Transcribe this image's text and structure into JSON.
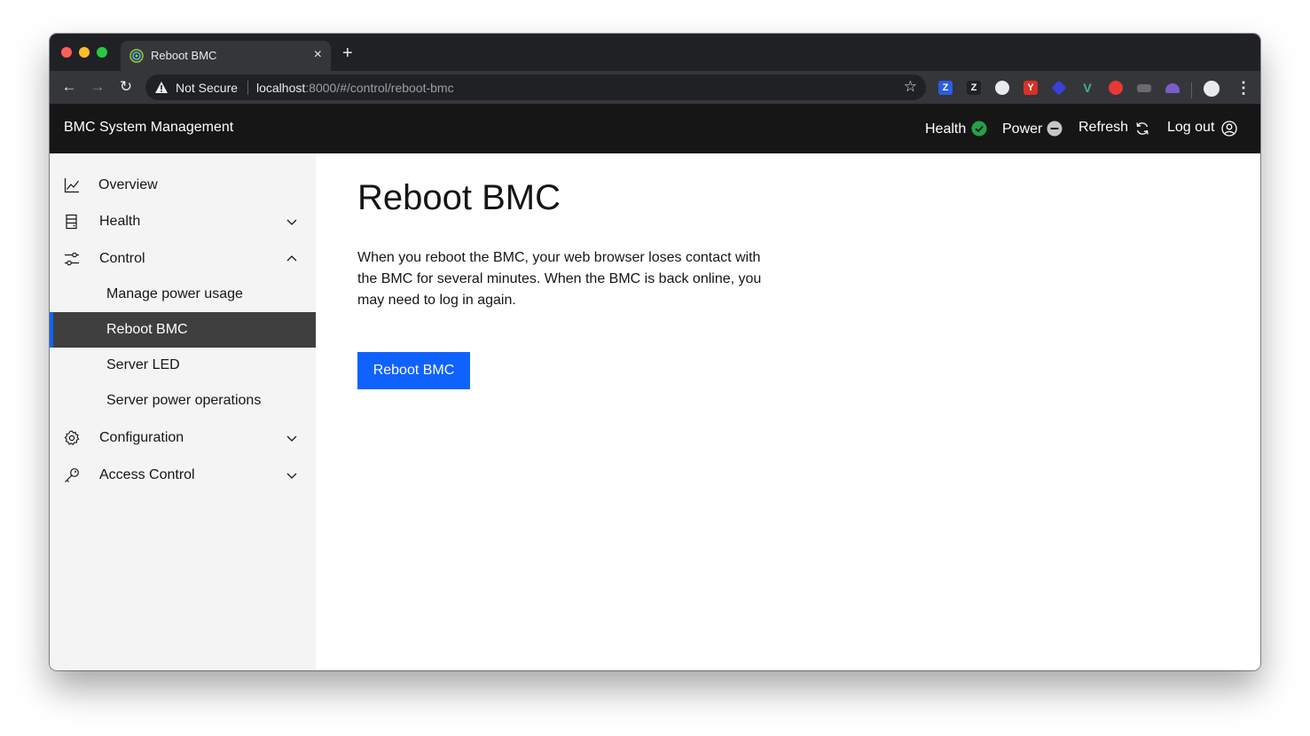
{
  "browser": {
    "tab_title": "Reboot BMC",
    "new_tab_symbol": "+",
    "close_symbol": "×",
    "security_label": "Not Secure",
    "url_host": "localhost",
    "url_rest": ":8000/#/control/reboot-bmc",
    "extensions": [
      {
        "icon": "z-blue-extension-icon",
        "glyph": "Z",
        "color": "#2d5be3"
      },
      {
        "icon": "z-dark-extension-icon",
        "glyph": "Z",
        "color": "#202124"
      },
      {
        "icon": "circle-extension-icon",
        "glyph": "",
        "color": "#e8eaed"
      },
      {
        "icon": "red-y-extension-icon",
        "glyph": "Y",
        "color": "#d93025"
      },
      {
        "icon": "diamond-extension-icon",
        "glyph": "",
        "color": "#3c3fd8"
      },
      {
        "icon": "vue-extension-icon",
        "glyph": "V",
        "color": "#41b883"
      },
      {
        "icon": "red-badge-extension-icon",
        "glyph": "",
        "color": "#e53935"
      },
      {
        "icon": "gray-extension-icon",
        "glyph": "",
        "color": "#6b6b6b"
      },
      {
        "icon": "purple-extension-icon",
        "glyph": "",
        "color": "#7a5cc9"
      }
    ]
  },
  "header": {
    "app_title": "BMC System Management",
    "health_label": "Health",
    "power_label": "Power",
    "refresh_label": "Refresh",
    "logout_label": "Log out",
    "health_color": "#24a148",
    "power_color": "#c6c6c6"
  },
  "sidebar": {
    "items": [
      {
        "label": "Overview",
        "icon": "chart-line-icon"
      },
      {
        "label": "Health",
        "icon": "server-icon",
        "expanded": false
      },
      {
        "label": "Control",
        "icon": "sliders-icon",
        "expanded": true
      },
      {
        "label": "Configuration",
        "icon": "gear-icon",
        "expanded": false
      },
      {
        "label": "Access Control",
        "icon": "key-icon",
        "expanded": false
      }
    ],
    "control_children": [
      {
        "label": "Manage power usage"
      },
      {
        "label": "Reboot BMC",
        "active": true
      },
      {
        "label": "Server LED"
      },
      {
        "label": "Server power operations"
      }
    ]
  },
  "main": {
    "title": "Reboot BMC",
    "description": "When you reboot the BMC, your web browser loses contact with the BMC for several minutes. When the BMC is back online, you may need to log in again.",
    "reboot_button_label": "Reboot BMC"
  },
  "colors": {
    "accent": "#0f62fe",
    "header_bg": "#161616",
    "sidebar_bg": "#f4f4f4",
    "active_nav_bg": "#3f3f3f"
  }
}
